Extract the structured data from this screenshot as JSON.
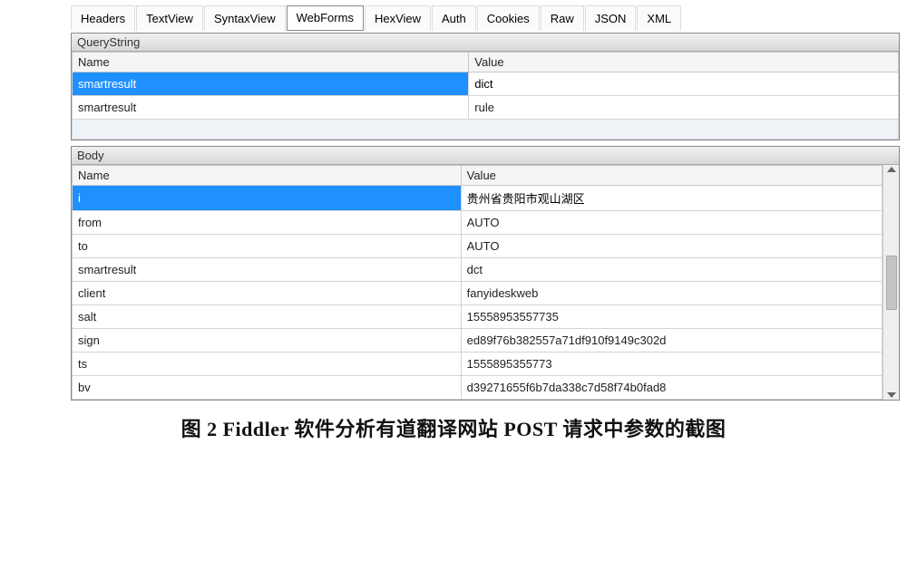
{
  "tabs": [
    {
      "label": "Headers"
    },
    {
      "label": "TextView"
    },
    {
      "label": "SyntaxView"
    },
    {
      "label": "WebForms",
      "active": true
    },
    {
      "label": "HexView"
    },
    {
      "label": "Auth"
    },
    {
      "label": "Cookies"
    },
    {
      "label": "Raw"
    },
    {
      "label": "JSON"
    },
    {
      "label": "XML"
    }
  ],
  "query": {
    "title": "QueryString",
    "headers": {
      "name": "Name",
      "value": "Value"
    },
    "rows": [
      {
        "name": "smartresult",
        "value": "dict",
        "selected": true
      },
      {
        "name": "smartresult",
        "value": "rule"
      }
    ]
  },
  "body": {
    "title": "Body",
    "headers": {
      "name": "Name",
      "value": "Value"
    },
    "rows": [
      {
        "name": "i",
        "value": "贵州省贵阳市观山湖区",
        "selected": true
      },
      {
        "name": "from",
        "value": "AUTO"
      },
      {
        "name": "to",
        "value": "AUTO"
      },
      {
        "name": "smartresult",
        "value": "dct"
      },
      {
        "name": "client",
        "value": "fanyideskweb"
      },
      {
        "name": "salt",
        "value": "15558953557735"
      },
      {
        "name": "sign",
        "value": "ed89f76b382557a71df910f9149c302d"
      },
      {
        "name": "ts",
        "value": "1555895355773"
      },
      {
        "name": "bv",
        "value": "d39271655f6b7da338c7d58f74b0fad8"
      }
    ]
  },
  "caption": "图 2  Fiddler 软件分析有道翻译网站 POST 请求中参数的截图"
}
